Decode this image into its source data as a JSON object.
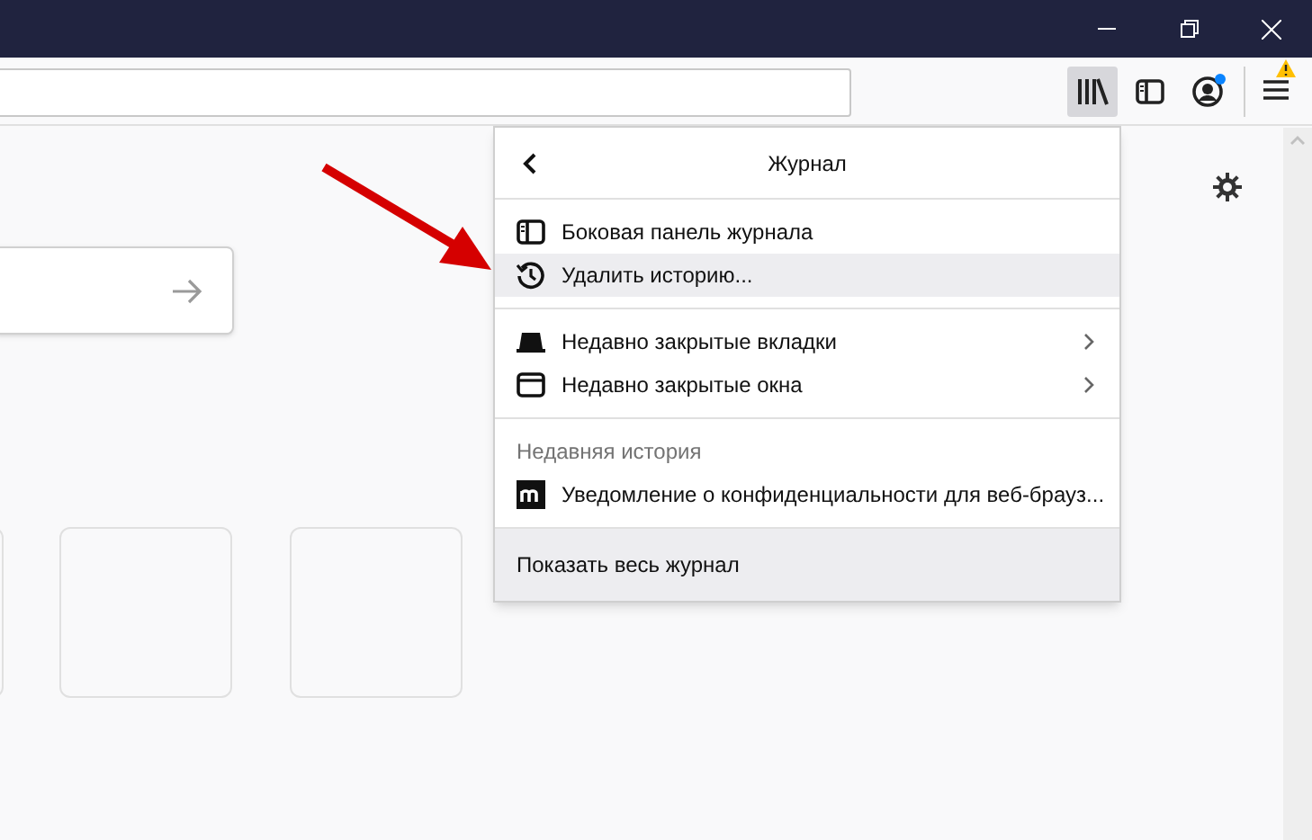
{
  "toolbar_buttons": [
    {
      "kind": "library",
      "selected": true
    },
    {
      "kind": "sidebar",
      "selected": false
    },
    {
      "kind": "account",
      "selected": false
    },
    {
      "kind": "menu",
      "selected": false
    }
  ],
  "history_panel": {
    "title": "Журнал",
    "groups": [
      {
        "items": [
          {
            "kind": "sidebar",
            "label": "Боковая панель журнала",
            "highlighted": false,
            "submenu": false
          },
          {
            "kind": "clock",
            "label": "Удалить историю...",
            "highlighted": true,
            "submenu": false
          }
        ]
      },
      {
        "items": [
          {
            "kind": "tab",
            "label": "Недавно закрытые вкладки",
            "highlighted": false,
            "submenu": true
          },
          {
            "kind": "window",
            "label": "Недавно закрытые окна",
            "highlighted": false,
            "submenu": true
          }
        ]
      },
      {
        "heading": "Недавняя история",
        "items": [
          {
            "kind": "site",
            "label": "Уведомление о конфиденциальности для веб-брауз...",
            "highlighted": false,
            "submenu": false
          }
        ]
      }
    ],
    "footer": "Показать весь журнал"
  }
}
